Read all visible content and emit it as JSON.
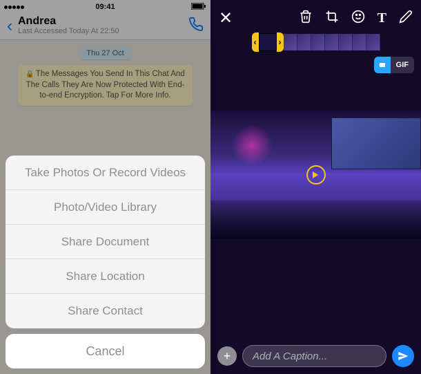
{
  "left": {
    "status": {
      "time": "09:41"
    },
    "nav": {
      "title": "Andrea",
      "subtitle": "Last Accessed Today At 22:50"
    },
    "chat": {
      "date_chip": "Thu 27 Oct",
      "system_message": "The Messages You Send In This Chat And The Calls They Are Now Protected With End-to-end Encryption. Tap For More Info."
    },
    "action_sheet": {
      "items": [
        "Take Photos Or Record Videos",
        "Photo/Video Library",
        "Share Document",
        "Share Location",
        "Share Contact"
      ],
      "cancel": "Cancel"
    }
  },
  "right": {
    "toggle": {
      "video": "",
      "gif": "GIF"
    },
    "caption_placeholder": "Add A Caption...",
    "colors": {
      "accent": "#1e88ff",
      "handle": "#f5c518"
    }
  }
}
